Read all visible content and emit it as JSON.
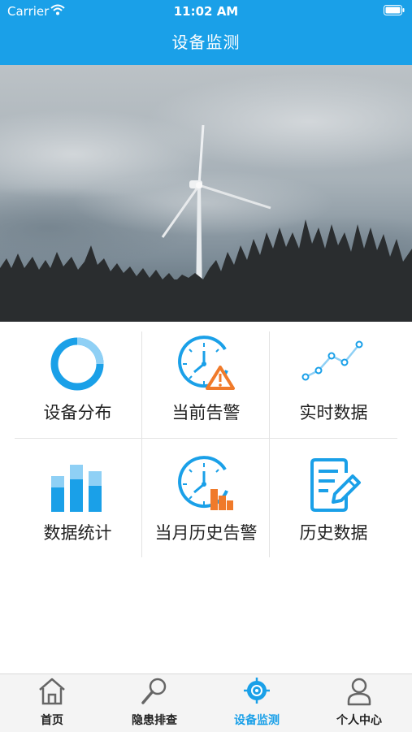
{
  "status_bar": {
    "carrier": "Carrier",
    "time": "11:02 AM"
  },
  "header": {
    "title": "设备监测"
  },
  "banner": {
    "image": "wind-turbine-forest-photo"
  },
  "menu": {
    "items": [
      {
        "label": "设备分布",
        "icon": "donut-chart-icon"
      },
      {
        "label": "当前告警",
        "icon": "clock-warning-icon"
      },
      {
        "label": "实时数据",
        "icon": "line-chart-icon"
      },
      {
        "label": "数据统计",
        "icon": "bar-chart-icon"
      },
      {
        "label": "当月历史告警",
        "icon": "clock-bars-icon"
      },
      {
        "label": "历史数据",
        "icon": "document-edit-icon"
      }
    ]
  },
  "tabbar": {
    "active_index": 2,
    "active_color": "#1aa0e8",
    "tabs": [
      {
        "label": "首页",
        "icon": "home-icon"
      },
      {
        "label": "隐患排查",
        "icon": "search-icon"
      },
      {
        "label": "设备监测",
        "icon": "target-icon"
      },
      {
        "label": "个人中心",
        "icon": "user-icon"
      }
    ]
  },
  "colors": {
    "primary": "#1aa0e8",
    "light_blue": "#8fd0f5",
    "warning": "#f07a2a"
  }
}
